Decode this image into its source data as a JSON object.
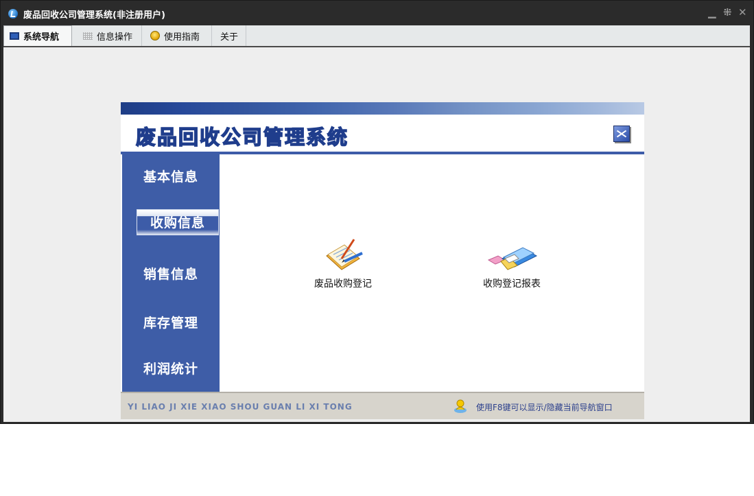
{
  "window": {
    "title": "废品回收公司管理系统(非注册用户)",
    "icons": [
      "app-logo-icon",
      "minimize-icon",
      "restore-icon",
      "close-icon"
    ],
    "minimize_glyph": "▁",
    "restore_glyph": "⁜",
    "close_glyph": "✕"
  },
  "menu": {
    "tabs": [
      {
        "label": "系统导航",
        "icon": "monitor-icon",
        "active": true
      },
      {
        "label": "信息操作",
        "icon": "grid-icon",
        "active": false
      },
      {
        "label": "使用指南",
        "icon": "coin-icon",
        "active": false
      },
      {
        "label": "关于",
        "icon": "",
        "active": false
      }
    ]
  },
  "nav": {
    "system_title": "废品回收公司管理系统",
    "sidebar": [
      {
        "label": "基本信息",
        "selected": false
      },
      {
        "label": "收购信息",
        "selected": true
      },
      {
        "label": "销售信息",
        "selected": false
      },
      {
        "label": "库存管理",
        "selected": false
      },
      {
        "label": "利润统计",
        "selected": false
      }
    ],
    "functions": [
      {
        "label": "废品收购登记",
        "icon": "notepad-pencil-icon"
      },
      {
        "label": "收购登记报表",
        "icon": "folder-files-icon"
      }
    ],
    "footer_left": "YI LIAO JI XIE XIAO SHOU GUAN LI XI TONG",
    "footer_tip": "使用F8键可以显示/隐藏当前导航窗口"
  },
  "colors": {
    "sidebar": "#3e5da7",
    "titlebar": "#2b2b2b",
    "footer": "#d7d4cc",
    "accent": "#1f3d8c"
  }
}
